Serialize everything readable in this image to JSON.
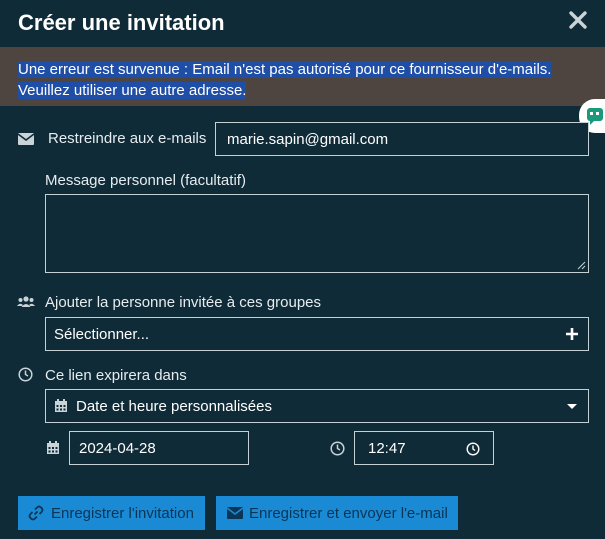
{
  "dialog": {
    "title": "Créer une invitation"
  },
  "error": {
    "line1": "Une erreur est survenue : Email n'est pas autorisé pour ce fournisseur d'e-mails.",
    "line2": "Veuillez utiliser une autre adresse."
  },
  "restrict": {
    "label": "Restreindre aux e-mails",
    "value": "marie.sapin@gmail.com"
  },
  "message": {
    "label": "Message personnel (facultatif)",
    "value": ""
  },
  "groups": {
    "label": "Ajouter la personne invitée à ces groupes",
    "placeholder": "Sélectionner..."
  },
  "expiry": {
    "label": "Ce lien expirera dans",
    "selected": "Date et heure personnalisées",
    "date": "2024-04-28",
    "time": "12:47"
  },
  "buttons": {
    "save": "Enregistrer l'invitation",
    "save_send": "Enregistrer et envoyer l'e-mail"
  },
  "colors": {
    "background": "#0f2b37",
    "error_bar": "#4e4440",
    "highlight": "#1f4ea6",
    "button": "#1a8ad4"
  }
}
